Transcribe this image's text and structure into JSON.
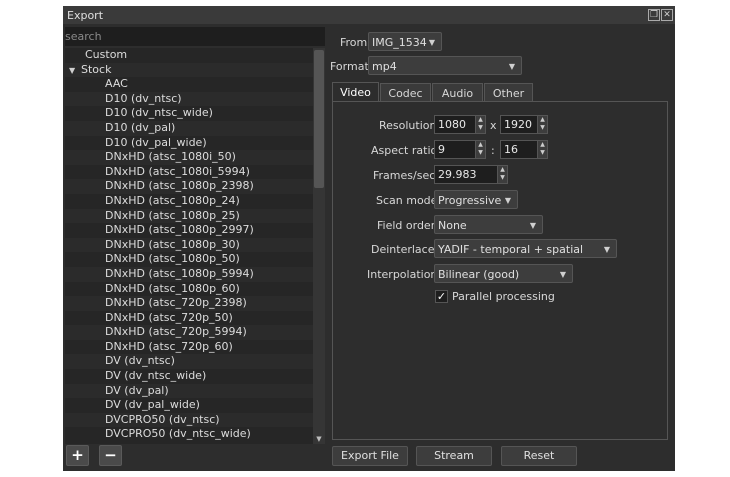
{
  "window": {
    "title": "Export"
  },
  "search": {
    "placeholder": "search"
  },
  "tree": {
    "items": [
      {
        "label": "Custom",
        "level": 1,
        "arrow": ""
      },
      {
        "label": "Stock",
        "level": 0,
        "arrow": "▼"
      },
      {
        "label": "AAC",
        "level": 2,
        "arrow": ""
      },
      {
        "label": "D10 (dv_ntsc)",
        "level": 2,
        "arrow": ""
      },
      {
        "label": "D10 (dv_ntsc_wide)",
        "level": 2,
        "arrow": ""
      },
      {
        "label": "D10 (dv_pal)",
        "level": 2,
        "arrow": ""
      },
      {
        "label": "D10 (dv_pal_wide)",
        "level": 2,
        "arrow": ""
      },
      {
        "label": "DNxHD (atsc_1080i_50)",
        "level": 2,
        "arrow": ""
      },
      {
        "label": "DNxHD (atsc_1080i_5994)",
        "level": 2,
        "arrow": ""
      },
      {
        "label": "DNxHD (atsc_1080p_2398)",
        "level": 2,
        "arrow": ""
      },
      {
        "label": "DNxHD (atsc_1080p_24)",
        "level": 2,
        "arrow": ""
      },
      {
        "label": "DNxHD (atsc_1080p_25)",
        "level": 2,
        "arrow": ""
      },
      {
        "label": "DNxHD (atsc_1080p_2997)",
        "level": 2,
        "arrow": ""
      },
      {
        "label": "DNxHD (atsc_1080p_30)",
        "level": 2,
        "arrow": ""
      },
      {
        "label": "DNxHD (atsc_1080p_50)",
        "level": 2,
        "arrow": ""
      },
      {
        "label": "DNxHD (atsc_1080p_5994)",
        "level": 2,
        "arrow": ""
      },
      {
        "label": "DNxHD (atsc_1080p_60)",
        "level": 2,
        "arrow": ""
      },
      {
        "label": "DNxHD (atsc_720p_2398)",
        "level": 2,
        "arrow": ""
      },
      {
        "label": "DNxHD (atsc_720p_50)",
        "level": 2,
        "arrow": ""
      },
      {
        "label": "DNxHD (atsc_720p_5994)",
        "level": 2,
        "arrow": ""
      },
      {
        "label": "DNxHD (atsc_720p_60)",
        "level": 2,
        "arrow": ""
      },
      {
        "label": "DV (dv_ntsc)",
        "level": 2,
        "arrow": ""
      },
      {
        "label": "DV (dv_ntsc_wide)",
        "level": 2,
        "arrow": ""
      },
      {
        "label": "DV (dv_pal)",
        "level": 2,
        "arrow": ""
      },
      {
        "label": "DV (dv_pal_wide)",
        "level": 2,
        "arrow": ""
      },
      {
        "label": "DVCPRO50 (dv_ntsc)",
        "level": 2,
        "arrow": ""
      },
      {
        "label": "DVCPRO50 (dv_ntsc_wide)",
        "level": 2,
        "arrow": ""
      }
    ]
  },
  "list_buttons": {
    "add": "+",
    "remove": "−"
  },
  "from": {
    "label": "From",
    "value": "IMG_1534"
  },
  "format": {
    "label": "Format",
    "value": "mp4"
  },
  "tabs": [
    "Video",
    "Codec",
    "Audio",
    "Other"
  ],
  "video": {
    "resolution": {
      "label": "Resolution",
      "width": "1080",
      "sep": "x",
      "height": "1920"
    },
    "aspect": {
      "label": "Aspect ratio",
      "num": "9",
      "sep": ":",
      "den": "16"
    },
    "fps": {
      "label": "Frames/sec",
      "value": "29.983"
    },
    "scan_mode": {
      "label": "Scan mode",
      "value": "Progressive"
    },
    "field_order": {
      "label": "Field order",
      "value": "None"
    },
    "deinterlacer": {
      "label": "Deinterlacer",
      "value": "YADIF - temporal + spatial (best)"
    },
    "interpolation": {
      "label": "Interpolation",
      "value": "Bilinear (good)"
    },
    "parallel": {
      "label": "Parallel processing",
      "checked": "✓"
    }
  },
  "actions": {
    "export": "Export File",
    "stream": "Stream",
    "reset": "Reset"
  },
  "icons": {
    "restore": "restore-icon",
    "close": "close-icon",
    "dropdown": "chevron-down-icon"
  }
}
